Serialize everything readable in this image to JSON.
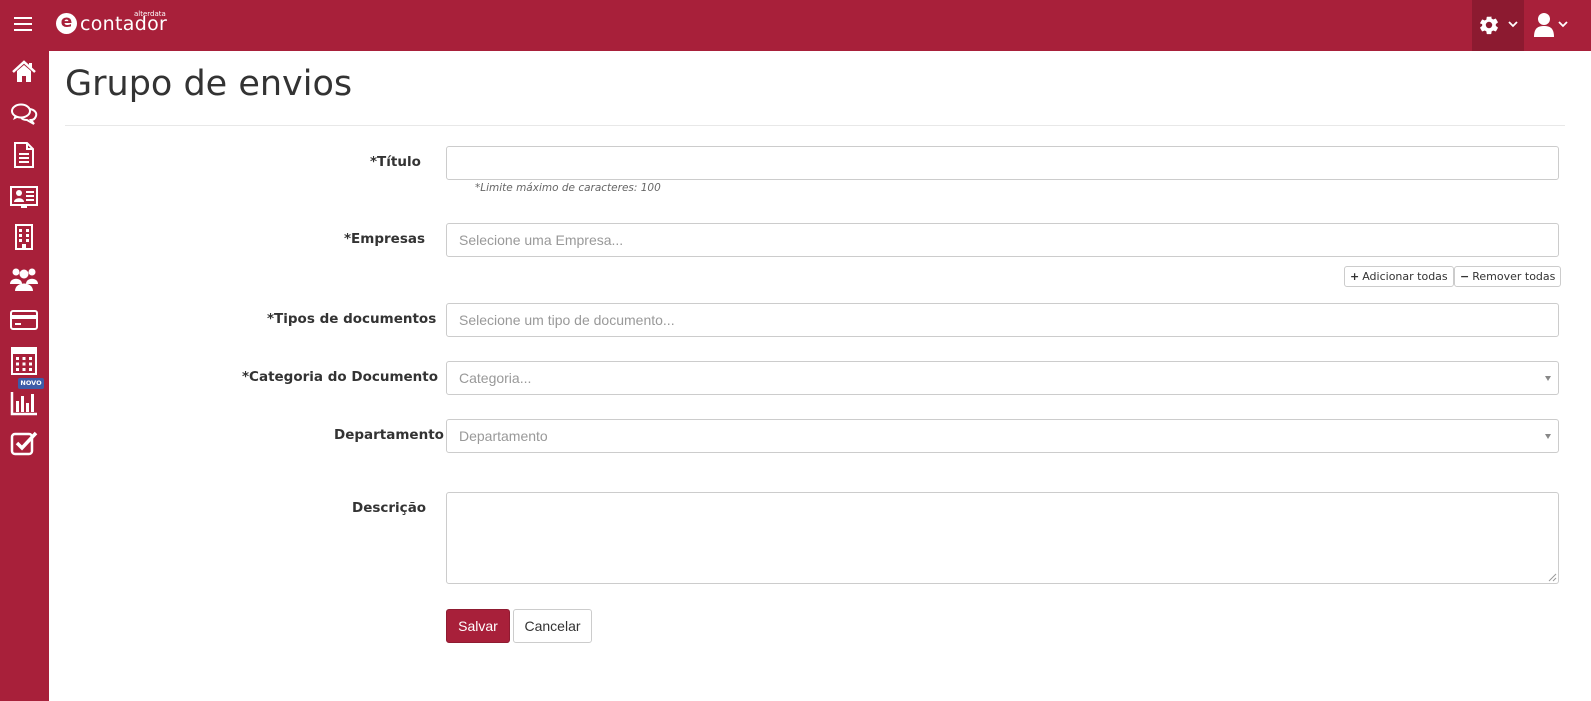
{
  "header": {
    "logo_text": "contador",
    "logo_superscript": "alterdata",
    "logo_letter": "e"
  },
  "sidebar": {
    "items": [
      {
        "icon": "home-icon"
      },
      {
        "icon": "chat-icon"
      },
      {
        "icon": "document-icon"
      },
      {
        "icon": "contact-card-icon"
      },
      {
        "icon": "building-icon"
      },
      {
        "icon": "users-icon"
      },
      {
        "icon": "credit-card-icon"
      },
      {
        "icon": "calculator-icon"
      },
      {
        "icon": "bar-chart-icon"
      },
      {
        "icon": "checkbox-icon"
      }
    ],
    "novo_badge": "NOVO"
  },
  "page": {
    "title": "Grupo de envios"
  },
  "form": {
    "titulo": {
      "label": "*Título",
      "value": "",
      "hint": "*Limite máximo de caracteres: 100"
    },
    "empresas": {
      "label": "*Empresas",
      "placeholder": "Selecione uma Empresa...",
      "add_all": "Adicionar todas",
      "remove_all": "Remover todas"
    },
    "tipos": {
      "label": "*Tipos de documentos",
      "placeholder": "Selecione um tipo de documento..."
    },
    "categoria": {
      "label": "*Categoria do Documento",
      "placeholder": "Categoria..."
    },
    "departamento": {
      "label": "Departamento",
      "placeholder": "Departamento"
    },
    "descricao": {
      "label": "Descrição",
      "value": ""
    },
    "save_label": "Salvar",
    "cancel_label": "Cancelar"
  },
  "colors": {
    "brand": "#a8203a",
    "badge": "#3d5ca8"
  }
}
